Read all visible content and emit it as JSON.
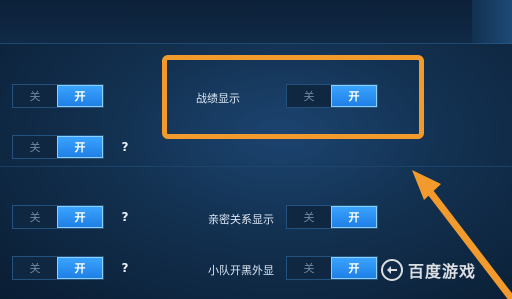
{
  "settings": {
    "toggle_off": "关",
    "toggle_on": "开",
    "help": "?",
    "battle_record": {
      "label": "战绩显示"
    },
    "intimacy": {
      "label": "亲密关系显示"
    },
    "squad_black": {
      "label": "小队开黑外显"
    }
  },
  "watermark": {
    "text": "百度游戏"
  },
  "colors": {
    "accent": "#2a8cf0",
    "highlight": "#f39a2c",
    "arrow": "#f39a2c"
  }
}
